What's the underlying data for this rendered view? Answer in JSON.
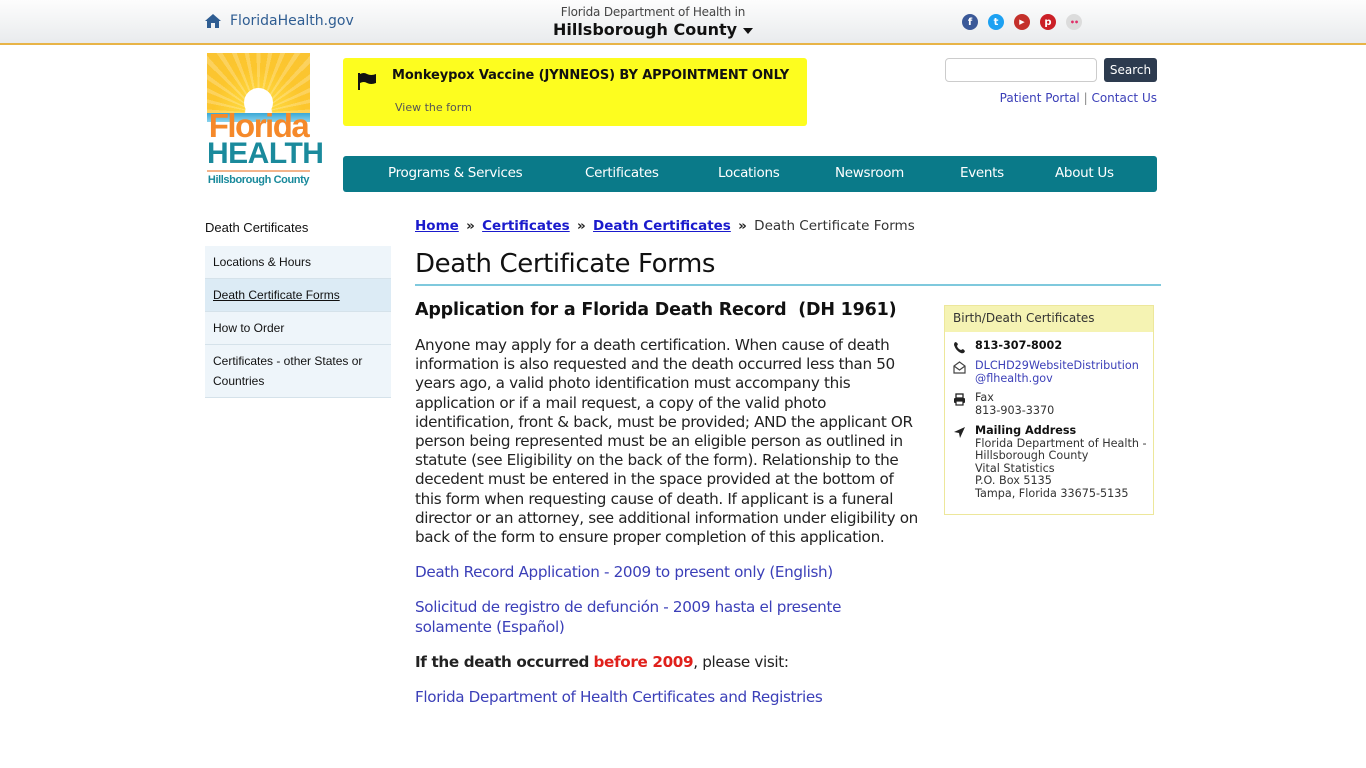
{
  "topbar": {
    "home_link": "FloridaHealth.gov",
    "dept_line": "Florida Department of Health in",
    "county": "Hillsborough County",
    "social": [
      {
        "name": "facebook",
        "glyph": "f",
        "color": "#3b5998"
      },
      {
        "name": "twitter",
        "glyph": "t",
        "color": "#1da1f2"
      },
      {
        "name": "youtube",
        "glyph": "▶",
        "color": "#c4302b"
      },
      {
        "name": "pinterest",
        "glyph": "p",
        "color": "#cb2027"
      },
      {
        "name": "flickr",
        "glyph": "••",
        "color": "#dcdcdc"
      }
    ]
  },
  "logo": {
    "line1": "Florida",
    "line2": "HEALTH",
    "line3": "Hillsborough County"
  },
  "alert": {
    "title": "Monkeypox Vaccine (JYNNEOS) BY APPOINTMENT ONLY",
    "link": "View the form",
    "background": "#fdfd1f"
  },
  "search": {
    "value": "",
    "placeholder": "",
    "button": "Search"
  },
  "toplinks": {
    "patient_portal": "Patient Portal",
    "separator": "|",
    "contact_us": "Contact Us"
  },
  "nav": {
    "items": [
      "Programs & Services",
      "Certificates",
      "Locations",
      "Newsroom",
      "Events",
      "About Us"
    ],
    "color": "#0a7a89"
  },
  "sidebar": {
    "title": "Death Certificates",
    "items": [
      {
        "label": "Locations & Hours",
        "active": false
      },
      {
        "label": "Death Certificate Forms",
        "active": true
      },
      {
        "label": "How to Order",
        "active": false
      },
      {
        "label": "Certificates - other States or Countries",
        "active": false
      }
    ]
  },
  "breadcrumb": {
    "items": [
      "Home",
      "Certificates",
      "Death Certificates"
    ],
    "separator": "»",
    "current": "Death Certificate Forms"
  },
  "page": {
    "title": "Death Certificate Forms",
    "heading": "Application for a Florida Death Record  (DH 1961)",
    "intro": "Anyone may apply for a death certification. When cause of death information is also requested and the death occurred less than 50 years ago, a valid photo identification must accompany this application or if a mail request, a copy of the valid photo identification, front & back, must be provided; AND the applicant OR person being represented must be an eligible person as outlined in statute (see Eligibility on the back of the form). Relationship to the decedent must be entered in the space provided at the bottom of this form when requesting cause of death. If applicant is a funeral director or an attorney, see additional information under eligibility on back of the form to ensure proper completion of this application.",
    "link_english": "Death Record Application - 2009 to present only (English)",
    "link_spanish": "Solicitud de registro de defunción - 2009 hasta el presente solamente (Español)",
    "before_bold": "If the death occurred",
    "before_red": "before 2009",
    "before_tail": ", please visit:",
    "link_state": "Florida Department of Health Certificates and Registries",
    "accent_red": "#e0201b"
  },
  "contact": {
    "title": "Birth/Death Certificates",
    "phone": "813-307-8002",
    "email_line1": "DLCHD29WebsiteDistribution",
    "email_line2": "@flhealth.gov",
    "fax_label": "Fax",
    "fax": "813-903-3370",
    "mail_label": "Mailing Address",
    "address": [
      "Florida Department of Health -",
      "Hillsborough County",
      "Vital Statistics",
      "P.O. Box 5135",
      "Tampa, Florida 33675-5135"
    ]
  }
}
